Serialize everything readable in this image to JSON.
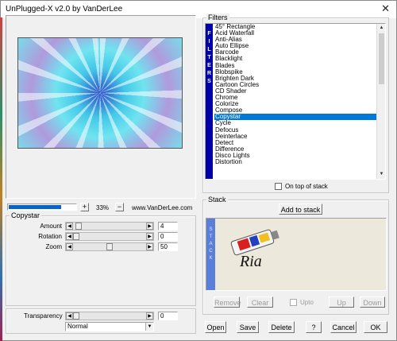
{
  "window": {
    "title": "UnPlugged-X v2.0 by VanDerLee",
    "close_glyph": "✕"
  },
  "preview": {
    "zoom_minus": "+",
    "zoom_value": "33%",
    "zoom_plus": "−",
    "website": "www.VanDerLee.com",
    "progress": 0.78
  },
  "filters": {
    "label": "Filters",
    "side_label": [
      "F",
      "I",
      "L",
      "T",
      "E",
      "R",
      "S"
    ],
    "items": [
      "45° Rectangle",
      "Acid Waterfall",
      "Anti-Alias",
      "Auto Ellipse",
      "Barcode",
      "Blacklight",
      "Blades",
      "Blobspike",
      "Brighten Dark",
      "Cartoon Circles",
      "CD Shader",
      "Chrome",
      "Colorize",
      "Compose",
      "Copystar",
      "Cycle",
      "Defocus",
      "Deinterlace",
      "Detect",
      "Difference",
      "Disco Lights",
      "Distortion"
    ],
    "selected_index": 14,
    "on_top_label": "On top of stack"
  },
  "params": {
    "label": "Copystar",
    "rows": [
      {
        "label": "Amount",
        "value": "4",
        "level": 0.03
      },
      {
        "label": "Rotation",
        "value": "0",
        "level": 0.0
      },
      {
        "label": "Zoom",
        "value": "50",
        "level": 0.5
      }
    ],
    "transparency": {
      "label": "Transparency",
      "value": "0",
      "level": 0.0
    },
    "blend_mode": "Normal"
  },
  "stack": {
    "label": "Stack",
    "add_button": "Add to stack",
    "side_label": [
      "S",
      "T",
      "A",
      "C",
      "K"
    ],
    "remove": "Remove",
    "clear": "Clear",
    "upto": "Upto",
    "up": "Up",
    "down": "Down",
    "watermark": "Ria"
  },
  "footer": {
    "open": "Open",
    "save": "Save",
    "delete": "Delete",
    "help": "?",
    "cancel": "Cancel",
    "ok": "OK"
  },
  "colors": {
    "selection": "#0078d7",
    "filters_side": "#0000a8",
    "stack_side": "#5a7fd8",
    "progress": "#0a64c8"
  }
}
